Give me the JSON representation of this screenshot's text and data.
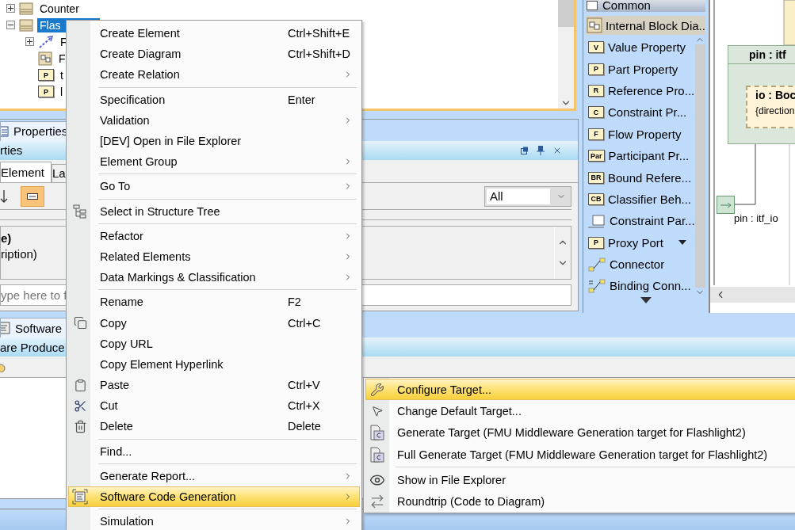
{
  "tree": {
    "items": [
      {
        "label": "Counter",
        "selected": false,
        "expanded": false,
        "kind": "block"
      },
      {
        "label": "Flas",
        "selected": true,
        "expanded": true,
        "kind": "block",
        "children": [
          {
            "label": "F",
            "selected": false,
            "kind": "relation",
            "expanded": false
          },
          {
            "label": "F",
            "selected": false,
            "kind": "diagram"
          },
          {
            "label": "t",
            "selected": false,
            "kind": "part",
            "badge": "P"
          },
          {
            "label": "l",
            "selected": false,
            "kind": "part",
            "badge": "P"
          }
        ]
      }
    ]
  },
  "properties": {
    "title": "Properties",
    "header": "rties",
    "tabs": [
      {
        "label": "Element",
        "selected": true
      },
      {
        "label": "La",
        "selected": false
      }
    ],
    "combo": "All",
    "lines": [
      {
        "text": "e)",
        "kind": "heading"
      },
      {
        "text": "ription)",
        "kind": "text"
      }
    ],
    "filter": {
      "placeholder": "ype here to f"
    }
  },
  "software_panel": {
    "tab": "Software",
    "header": "are Produce"
  },
  "palette": {
    "section": "Common",
    "group": "Internal Block Dia..",
    "items": [
      {
        "label": "Value Property",
        "kind": "badge",
        "badge": "V"
      },
      {
        "label": "Part Property",
        "kind": "badge",
        "badge": "P"
      },
      {
        "label": "Reference Pro...",
        "kind": "badge",
        "badge": "R"
      },
      {
        "label": "Constraint Pr...",
        "kind": "badge",
        "badge": "C"
      },
      {
        "label": "Flow Property",
        "kind": "badge",
        "badge": "F"
      },
      {
        "label": "Participant Pr...",
        "kind": "badge",
        "badge": "Par"
      },
      {
        "label": "Bound Refere...",
        "kind": "badge",
        "badge": "BR"
      },
      {
        "label": "Classifier Beh...",
        "kind": "badge",
        "badge": "CB"
      },
      {
        "label": "Constraint Par...",
        "kind": "constraint"
      },
      {
        "label": "Proxy Port",
        "kind": "port",
        "badge": "P"
      },
      {
        "label": "Connector",
        "kind": "connector"
      },
      {
        "label": "Binding Conn...",
        "kind": "binding"
      }
    ]
  },
  "diagram": {
    "block": "pin : itf",
    "part": "io : Boc",
    "part_note": "{direction",
    "port_label": "pin : itf_io"
  },
  "context_menu": {
    "items": [
      {
        "kind": "item",
        "label": "Create Element",
        "shortcut": "Ctrl+Shift+E",
        "submenu": false,
        "selected": false
      },
      {
        "kind": "item",
        "label": "Create Diagram",
        "shortcut": "Ctrl+Shift+D",
        "submenu": false,
        "selected": false
      },
      {
        "kind": "item",
        "label": "Create Relation",
        "submenu": true,
        "selected": false
      },
      {
        "kind": "separator"
      },
      {
        "kind": "item",
        "label": "Specification",
        "shortcut": "Enter",
        "submenu": false,
        "selected": false
      },
      {
        "kind": "item",
        "label": "Validation",
        "submenu": true,
        "selected": false
      },
      {
        "kind": "item",
        "label": "[DEV] Open in File Explorer",
        "submenu": false,
        "selected": false
      },
      {
        "kind": "item",
        "label": "Element Group",
        "submenu": true,
        "selected": false
      },
      {
        "kind": "separator"
      },
      {
        "kind": "item",
        "label": "Go To",
        "submenu": true,
        "selected": false
      },
      {
        "kind": "separator"
      },
      {
        "kind": "item",
        "label": "Select in Structure Tree",
        "submenu": false,
        "selected": false
      },
      {
        "kind": "separator"
      },
      {
        "kind": "item",
        "label": "Refactor",
        "submenu": true,
        "selected": false
      },
      {
        "kind": "item",
        "label": "Related Elements",
        "submenu": true,
        "selected": false
      },
      {
        "kind": "item",
        "label": "Data Markings & Classification",
        "submenu": true,
        "selected": false
      },
      {
        "kind": "separator"
      },
      {
        "kind": "item",
        "label": "Rename",
        "shortcut": "F2",
        "submenu": false,
        "selected": false
      },
      {
        "kind": "item",
        "label": "Copy",
        "shortcut": "Ctrl+C",
        "submenu": false,
        "selected": false
      },
      {
        "kind": "item",
        "label": "Copy URL",
        "submenu": false,
        "selected": false
      },
      {
        "kind": "item",
        "label": "Copy Element Hyperlink",
        "submenu": false,
        "selected": false
      },
      {
        "kind": "item",
        "label": "Paste",
        "shortcut": "Ctrl+V",
        "submenu": false,
        "selected": false
      },
      {
        "kind": "item",
        "label": "Cut",
        "shortcut": "Ctrl+X",
        "submenu": false,
        "selected": false
      },
      {
        "kind": "item",
        "label": "Delete",
        "shortcut": "Delete",
        "submenu": false,
        "selected": false
      },
      {
        "kind": "separator"
      },
      {
        "kind": "item",
        "label": "Find...",
        "submenu": false,
        "selected": false
      },
      {
        "kind": "separator"
      },
      {
        "kind": "item",
        "label": "Generate Report...",
        "submenu": true,
        "selected": false
      },
      {
        "kind": "item",
        "label": "Software Code Generation",
        "submenu": true,
        "selected": true
      },
      {
        "kind": "separator"
      },
      {
        "kind": "item",
        "label": "Simulation",
        "submenu": true,
        "selected": false
      }
    ]
  },
  "submenu": {
    "items": [
      {
        "kind": "item",
        "label": "Configure Target...",
        "selected": true
      },
      {
        "kind": "item",
        "label": "Change Default Target...",
        "selected": false
      },
      {
        "kind": "item",
        "label": "Generate Target (FMU Middleware Generation target for Flashlight2)",
        "selected": false
      },
      {
        "kind": "item",
        "label": "Full Generate Target (FMU Middleware Generation target for Flashlight2)",
        "selected": false
      },
      {
        "kind": "separator"
      },
      {
        "kind": "item",
        "label": "Show in File Explorer",
        "selected": false
      },
      {
        "kind": "item",
        "label": "Roundtrip (Code to Diagram)",
        "selected": false
      }
    ]
  }
}
